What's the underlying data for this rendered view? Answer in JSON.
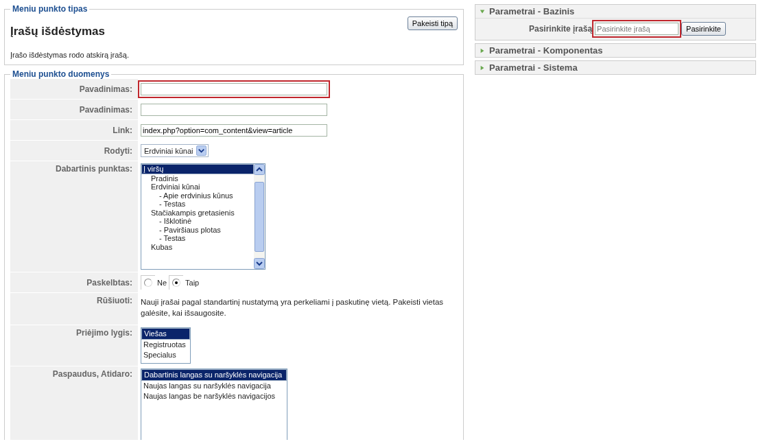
{
  "type_section": {
    "legend": "Meniu punkto tipas",
    "title": "Įrašų išdėstymas",
    "description": "Įrašo išdėstymas rodo atskirą įrašą.",
    "button": "Pakeisti tipą"
  },
  "details": {
    "legend": "Meniu punkto duomenys",
    "rows": [
      {
        "kind": "input",
        "label": "Pavadinimas:",
        "value": "",
        "highlighted": true
      },
      {
        "kind": "input",
        "label": "Pavadinimas:",
        "value": "",
        "highlighted": false
      },
      {
        "kind": "input",
        "label": "Link:",
        "value": "index.php?option=com_content&view=article",
        "highlighted": false
      },
      {
        "kind": "select",
        "label": "Rodyti:",
        "value": "Erdviniai kūnai"
      },
      {
        "kind": "tree",
        "label": "Dabartinis punktas:",
        "items": [
          {
            "label": "Į viršų",
            "selected": true,
            "children": [
              {
                "label": "Pradinis",
                "selected": false
              },
              {
                "label": "Erdviniai kūnai",
                "selected": false,
                "children": [
                  {
                    "label": "- Apie erdvinius kūnus",
                    "selected": false
                  },
                  {
                    "label": "- Testas",
                    "selected": false
                  }
                ]
              },
              {
                "label": "Stačiakampis gretasienis",
                "selected": false,
                "children": [
                  {
                    "label": "- Išklotinė",
                    "selected": false
                  },
                  {
                    "label": "- Paviršiaus plotas",
                    "selected": false
                  },
                  {
                    "label": "- Testas",
                    "selected": false
                  }
                ]
              },
              {
                "label": "Kubas",
                "selected": false
              }
            ]
          }
        ]
      },
      {
        "kind": "radio",
        "label": "Paskelbtas:",
        "options": [
          {
            "label": "Ne",
            "selected": false
          },
          {
            "label": "Taip",
            "selected": true
          }
        ]
      },
      {
        "kind": "note",
        "label": "Rūšiuoti:",
        "text": "Nauji įrašai pagal standartinį nustatymą yra perkeliami į paskutinę vietą. Pakeisti vietas galėsite, kai išsaugosite."
      },
      {
        "kind": "list",
        "label": "Priėjimo lygis:",
        "items": [
          {
            "label": "Viešas",
            "selected": true
          },
          {
            "label": "Registruotas",
            "selected": false
          },
          {
            "label": "Specialus",
            "selected": false
          }
        ]
      },
      {
        "kind": "list",
        "label": "Paspaudus, Atidaro:",
        "items": [
          {
            "label": "Dabartinis langas su naršyklės navigacija",
            "selected": true
          },
          {
            "label": "Naujas langas su naršyklės navigacija",
            "selected": false
          },
          {
            "label": "Naujas langas be naršyklės navigacijos",
            "selected": false
          }
        ]
      }
    ]
  },
  "panels": [
    {
      "title": "Parametrai - Bazinis",
      "expanded": true,
      "field_label": "Pasirinkite įrašą",
      "placeholder": "Pasirinkite įrašą",
      "highlighted": true,
      "button": "Pasirinkite"
    },
    {
      "title": "Parametrai - Komponentas",
      "expanded": false
    },
    {
      "title": "Parametrai - Sistema",
      "expanded": false
    }
  ]
}
